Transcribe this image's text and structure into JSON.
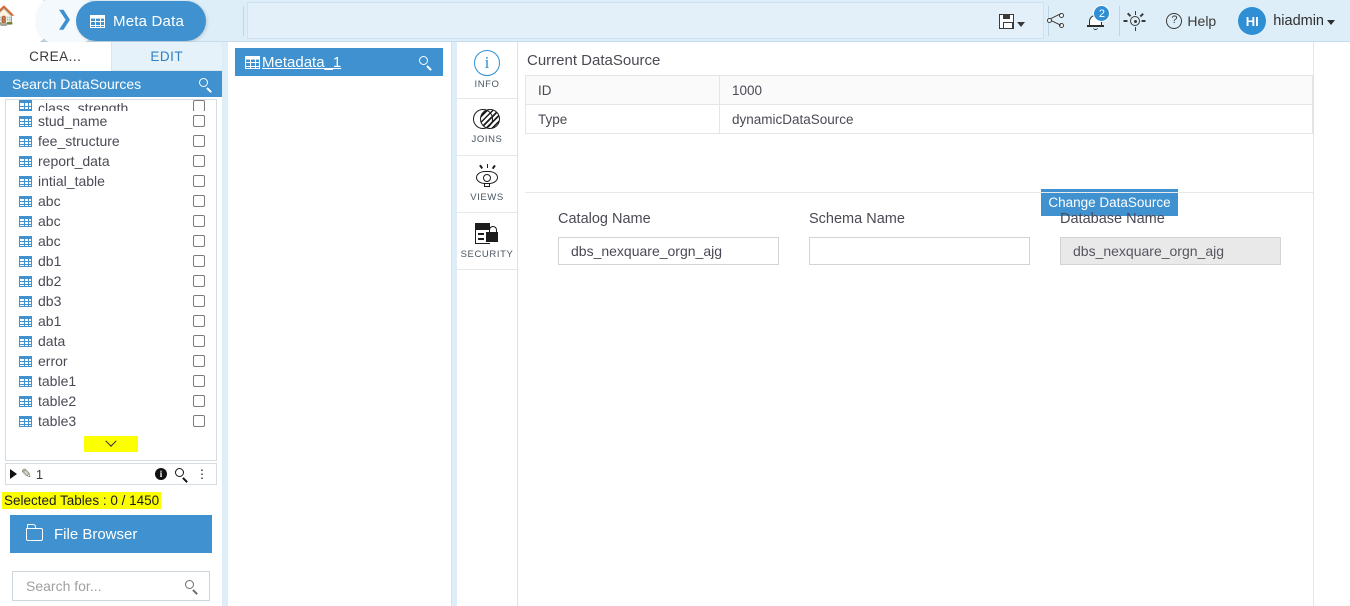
{
  "header": {
    "home_icon": "home-icon",
    "chevron_icon": "chevron-right-icon",
    "breadcrumb": "Meta Data",
    "breadcrumb_icon": "table-grid-icon",
    "save_icon": "save-icon",
    "share_icon": "share-icon",
    "notifications_icon": "bell-icon",
    "notifications_count": "2",
    "ideas_icon": "lightbulb-icon",
    "help_icon": "question-circle-icon",
    "help_label": "Help",
    "avatar_initials": "HI",
    "username": "hiadmin"
  },
  "sidebar": {
    "tabs": [
      {
        "label": "CREA...",
        "active": true
      },
      {
        "label": "EDIT",
        "active": false
      }
    ],
    "search_datasources": {
      "label": "Search DataSources",
      "icon": "search-icon"
    },
    "tables": [
      {
        "name": "class_strength",
        "checked": false
      },
      {
        "name": "stud_name",
        "checked": false
      },
      {
        "name": "fee_structure",
        "checked": false
      },
      {
        "name": "report_data",
        "checked": false
      },
      {
        "name": "intial_table",
        "checked": false
      },
      {
        "name": "abc",
        "checked": false
      },
      {
        "name": "abc",
        "checked": false
      },
      {
        "name": "abc",
        "checked": false
      },
      {
        "name": "db1",
        "checked": false
      },
      {
        "name": "db2",
        "checked": false
      },
      {
        "name": "db3",
        "checked": false
      },
      {
        "name": "ab1",
        "checked": false
      },
      {
        "name": "data",
        "checked": false
      },
      {
        "name": "error",
        "checked": false
      },
      {
        "name": "table1",
        "checked": false
      },
      {
        "name": "table2",
        "checked": false
      },
      {
        "name": "table3",
        "checked": false
      }
    ],
    "expander_icon": "chevron-down-icon",
    "minibar": {
      "play_icon": "play-icon",
      "edit_icon": "pencil-icon",
      "count": "1",
      "info_icon": "info-icon",
      "search_icon": "search-icon",
      "more_icon": "kebab-menu-icon"
    },
    "selected_tables": "Selected Tables : 0 / 1450",
    "file_browser": {
      "label": "File Browser",
      "icon": "folder-icon"
    },
    "bottom_search": {
      "placeholder": "Search for...",
      "value": "",
      "icon": "search-icon"
    }
  },
  "center_panel": {
    "tab_label": "Metadata_1",
    "tab_icon": "table-grid-icon",
    "tab_search_icon": "search-icon"
  },
  "rail": [
    {
      "label": "INFO",
      "icon": "info-circle-icon",
      "active": true
    },
    {
      "label": "JOINS",
      "icon": "venn-joins-icon",
      "active": false
    },
    {
      "label": "VIEWS",
      "icon": "eye-views-icon",
      "active": false
    },
    {
      "label": "SECURITY",
      "icon": "server-lock-icon",
      "active": false
    }
  ],
  "main": {
    "section_title": "Current DataSource",
    "rows": [
      {
        "key": "ID",
        "value": "1000"
      },
      {
        "key": "Type",
        "value": "dynamicDataSource"
      }
    ],
    "change_button": "Change DataSource",
    "fields": [
      {
        "label": "Catalog Name",
        "value": "dbs_nexquare_orgn_ajg",
        "disabled": false
      },
      {
        "label": "Schema Name",
        "value": "",
        "disabled": false
      },
      {
        "label": "Database Name",
        "value": "dbs_nexquare_orgn_ajg",
        "disabled": true
      }
    ]
  },
  "colors": {
    "accent_blue": "#3f92cf",
    "header_bg": "#ddeef8",
    "highlight_yellow": "#fcff00"
  }
}
